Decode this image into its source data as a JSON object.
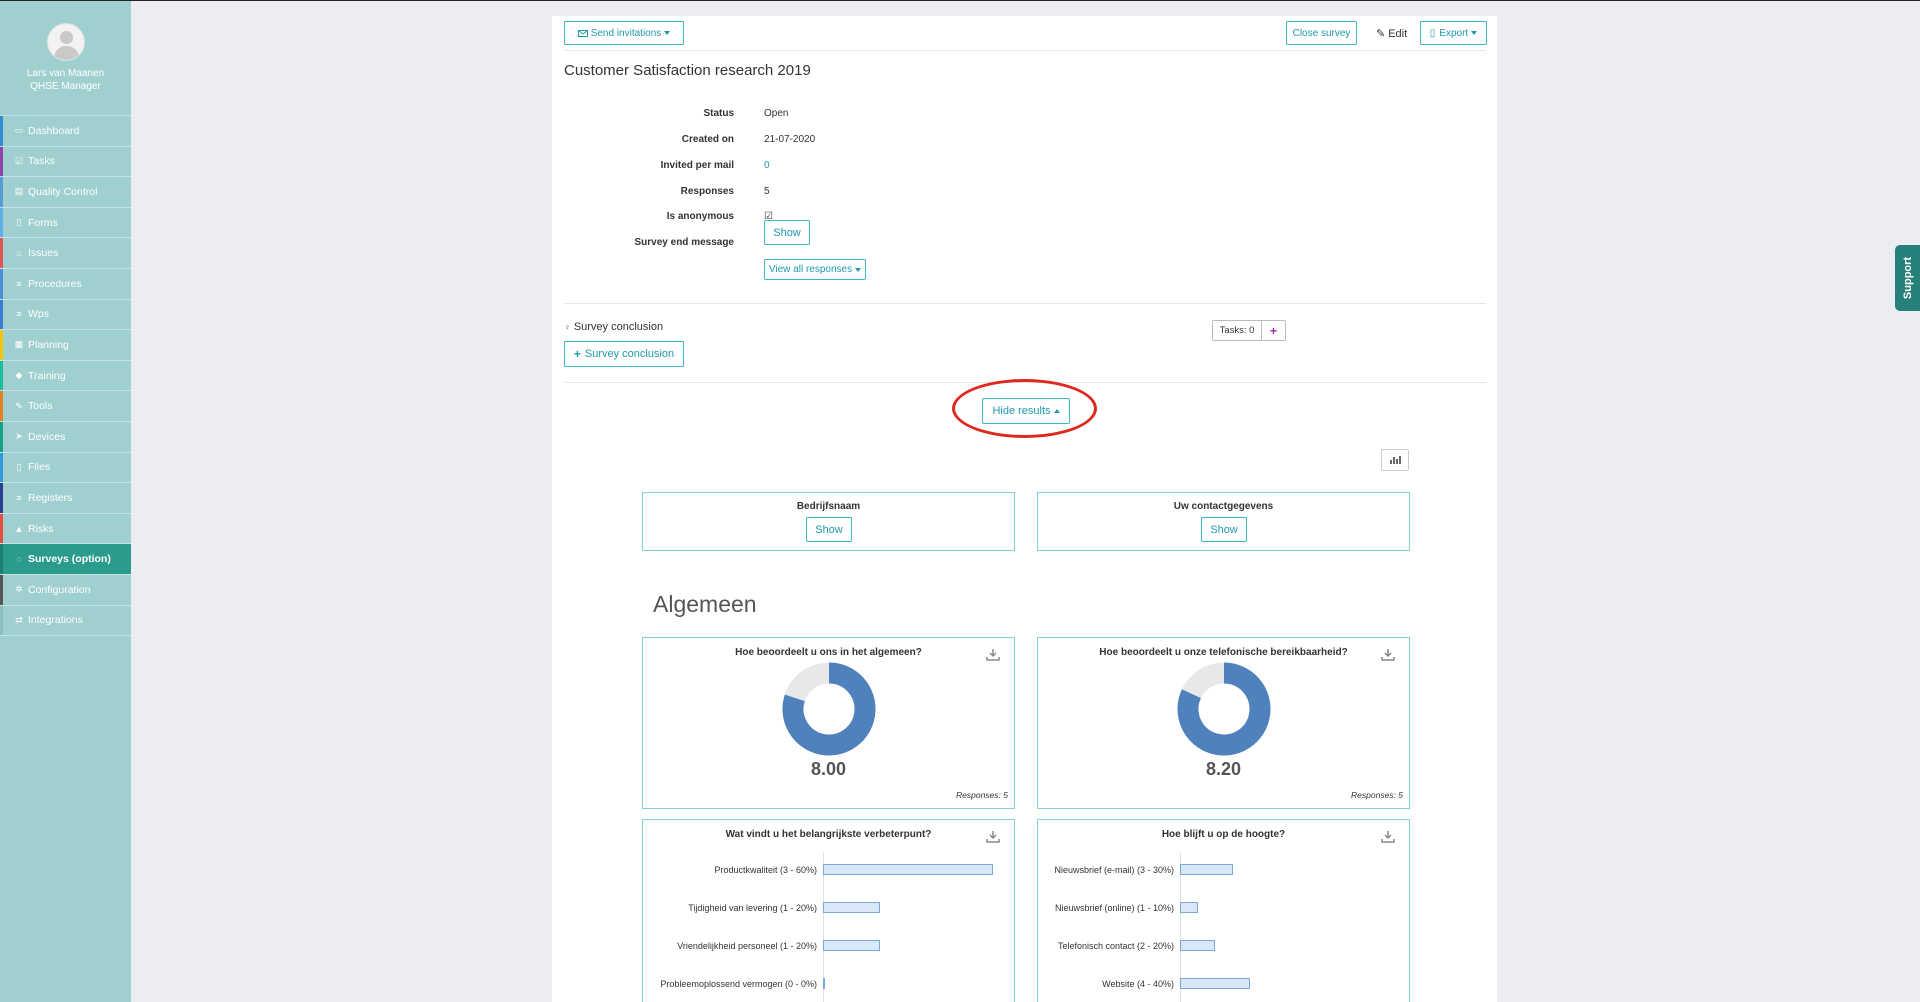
{
  "user": {
    "name": "Lars van Maanen",
    "role": "QHSE Manager"
  },
  "nav": [
    {
      "label": "Dashboard",
      "icon": "monitor-icon",
      "glyph": "▭",
      "stripe": "#2f8fd0",
      "active": false
    },
    {
      "label": "Tasks",
      "icon": "checkbox-icon",
      "glyph": "☑",
      "stripe": "#8e44ad",
      "active": false
    },
    {
      "label": "Quality Control",
      "icon": "book-icon",
      "glyph": "▤",
      "stripe": "#5b9bd5",
      "active": false
    },
    {
      "label": "Forms",
      "icon": "file-icon",
      "glyph": "▯",
      "stripe": "#5fb0e8",
      "active": false
    },
    {
      "label": "Issues",
      "icon": "bell-icon",
      "glyph": "⌂",
      "stripe": "#e25555",
      "active": false
    },
    {
      "label": "Procedures",
      "icon": "list-icon",
      "glyph": "≡",
      "stripe": "#4a90d9",
      "active": false
    },
    {
      "label": "Wps",
      "icon": "list-icon",
      "glyph": "≡",
      "stripe": "#3a7bd5",
      "active": false
    },
    {
      "label": "Planning",
      "icon": "calendar-icon",
      "glyph": "▦",
      "stripe": "#f1c40f",
      "active": false
    },
    {
      "label": "Training",
      "icon": "graduation-cap-icon",
      "glyph": "◆",
      "stripe": "#1abc9c",
      "active": false
    },
    {
      "label": "Tools",
      "icon": "wrench-icon",
      "glyph": "✎",
      "stripe": "#e67e22",
      "active": false
    },
    {
      "label": "Devices",
      "icon": "location-arrow-icon",
      "glyph": "➤",
      "stripe": "#16a085",
      "active": false
    },
    {
      "label": "Files",
      "icon": "file-icon",
      "glyph": "▯",
      "stripe": "#3498db",
      "active": false
    },
    {
      "label": "Registers",
      "icon": "list-icon",
      "glyph": "≡",
      "stripe": "#2c3e90",
      "active": false
    },
    {
      "label": "Risks",
      "icon": "warning-icon",
      "glyph": "▲",
      "stripe": "#e74c3c",
      "active": false
    },
    {
      "label": "Surveys (option)",
      "icon": "comment-icon",
      "glyph": "◌",
      "stripe": "#1d7f72",
      "active": true
    },
    {
      "label": "Configuration",
      "icon": "gear-icon",
      "glyph": "✲",
      "stripe": "#555555",
      "active": false
    },
    {
      "label": "Integrations",
      "icon": "exchange-icon",
      "glyph": "⇄",
      "stripe": "#8bbfbf",
      "active": false
    }
  ],
  "support_label": "Support",
  "toolbar": {
    "send_invitations": "Send invitations",
    "close_survey": "Close survey",
    "edit": "Edit",
    "export": "Export"
  },
  "survey": {
    "title": "Customer Satisfaction research 2019",
    "details": [
      {
        "label": "Status",
        "value": "Open"
      },
      {
        "label": "Created on",
        "value": "21-07-2020"
      },
      {
        "label": "Invited per mail",
        "value": "0"
      },
      {
        "label": "Responses",
        "value": "5"
      },
      {
        "label": "Is anonymous",
        "value": "☑"
      },
      {
        "label": "Survey end message",
        "value": ""
      }
    ],
    "show_label": "Show",
    "view_all_responses": "View all responses"
  },
  "conclusion": {
    "label": "Survey conclusion",
    "button": "Survey conclusion",
    "tasks": "Tasks: 0",
    "add": "+"
  },
  "hide_results": "Hide results",
  "text_questions": [
    {
      "title": "Bedrijfsnaam",
      "button": "Show"
    },
    {
      "title": "Uw contactgegevens",
      "button": "Show"
    }
  ],
  "section_title": "Algemeen",
  "colors": {
    "accent": "#1f9aab",
    "donut_fill": "#4f81bd",
    "donut_rest": "#e8e8e8",
    "active_nav": "#2b9c8c",
    "highlight_ring": "#e0281e"
  },
  "chart_data": [
    {
      "type": "pie",
      "title": "Hoe beoordeelt u ons in het algemeen?",
      "score": "8.00",
      "responses": "Responses: 5",
      "fraction": 0.8
    },
    {
      "type": "pie",
      "title": "Hoe beoordeelt u onze telefonische bereikbaarheid?",
      "score": "8.20",
      "responses": "Responses: 5",
      "fraction": 0.82
    },
    {
      "type": "bar",
      "title": "Wat vindt u het belangrijkste verbeterpunt?",
      "categories": [
        "Productkwaliteit (3 - 60%)",
        "Tijdigheid van levering (1 - 20%)",
        "Vriendelijkheid personeel (1 - 20%)",
        "Probleemoplossend vermogen (0 - 0%)"
      ],
      "values": [
        60,
        20,
        20,
        0
      ]
    },
    {
      "type": "bar",
      "title": "Hoe blijft u op de hoogte?",
      "categories": [
        "Nieuwsbrief (e-mail) (3 - 30%)",
        "Nieuwsbrief (online) (1 - 10%)",
        "Telefonisch contact (2 - 20%)",
        "Website (4 - 40%)"
      ],
      "values": [
        30,
        10,
        20,
        40
      ]
    }
  ]
}
